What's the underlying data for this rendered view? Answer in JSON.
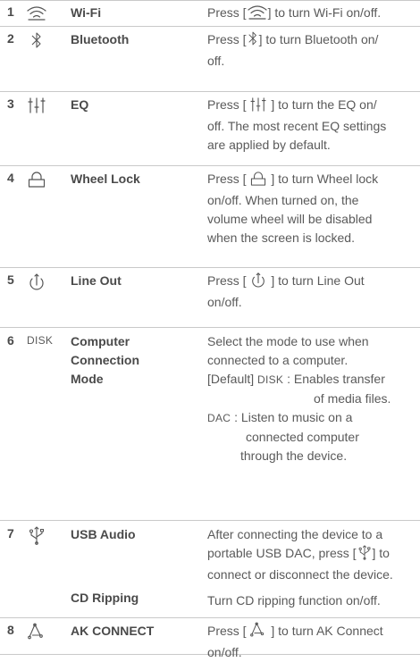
{
  "rows": [
    {
      "num": "1",
      "icon": "wifi-icon",
      "name": "Wi-Fi",
      "desc_pre": "Press [",
      "desc_post": "] to turn Wi-Fi on/off."
    },
    {
      "num": "2",
      "icon": "bluetooth-icon",
      "name": "Bluetooth",
      "desc_pre": "Press [",
      "desc_post": "] to turn Bluetooth on/",
      "desc_line2": "off."
    },
    {
      "num": "3",
      "icon": "eq-icon",
      "name": "EQ",
      "desc_pre": "Press [",
      "desc_post": "] to turn the EQ on/",
      "desc_line2": "off. The most recent EQ settings",
      "desc_line3": "are applied by default."
    },
    {
      "num": "4",
      "icon": "lock-icon",
      "name": "Wheel Lock",
      "desc_pre": "Press [",
      "desc_post": "] to turn Wheel lock",
      "desc_line2": "on/off. When turned on, the",
      "desc_line3": "volume wheel will be disabled",
      "desc_line4": "when the screen is locked."
    },
    {
      "num": "5",
      "icon": "line-out-icon",
      "name": "Line Out",
      "desc_pre": "Press [",
      "desc_post": "] to turn Line Out",
      "desc_line2": "on/off."
    },
    {
      "num": "6",
      "icon_text": "DISK",
      "name_line1": "Computer",
      "name_line2": "Connection",
      "name_line3": "Mode",
      "desc_line1": "Select the mode to use when",
      "desc_line2": "connected to a computer.",
      "default_label": "[Default]",
      "disk_tag": "DISK",
      "disk_desc_1": ": Enables transfer",
      "disk_desc_2": "of media files.",
      "dac_tag": "DAC",
      "dac_desc_1": ": Listen to music on a",
      "dac_desc_2": "connected computer",
      "dac_desc_3": "through the device."
    },
    {
      "num": "7",
      "icon": "usb-icon",
      "name": "USB Audio",
      "desc_line1": "After connecting the device to a",
      "desc_pre": "portable USB DAC, press [",
      "desc_post": "] to",
      "desc_line3": "connect or disconnect the device.",
      "name2": "CD Ripping",
      "desc2": "Turn CD ripping function on/off."
    },
    {
      "num": "8",
      "icon": "ak-connect-icon",
      "name": "AK CONNECT",
      "desc_pre": "Press [",
      "desc_post": "] to turn AK Connect",
      "desc_line2": "on/off."
    }
  ]
}
